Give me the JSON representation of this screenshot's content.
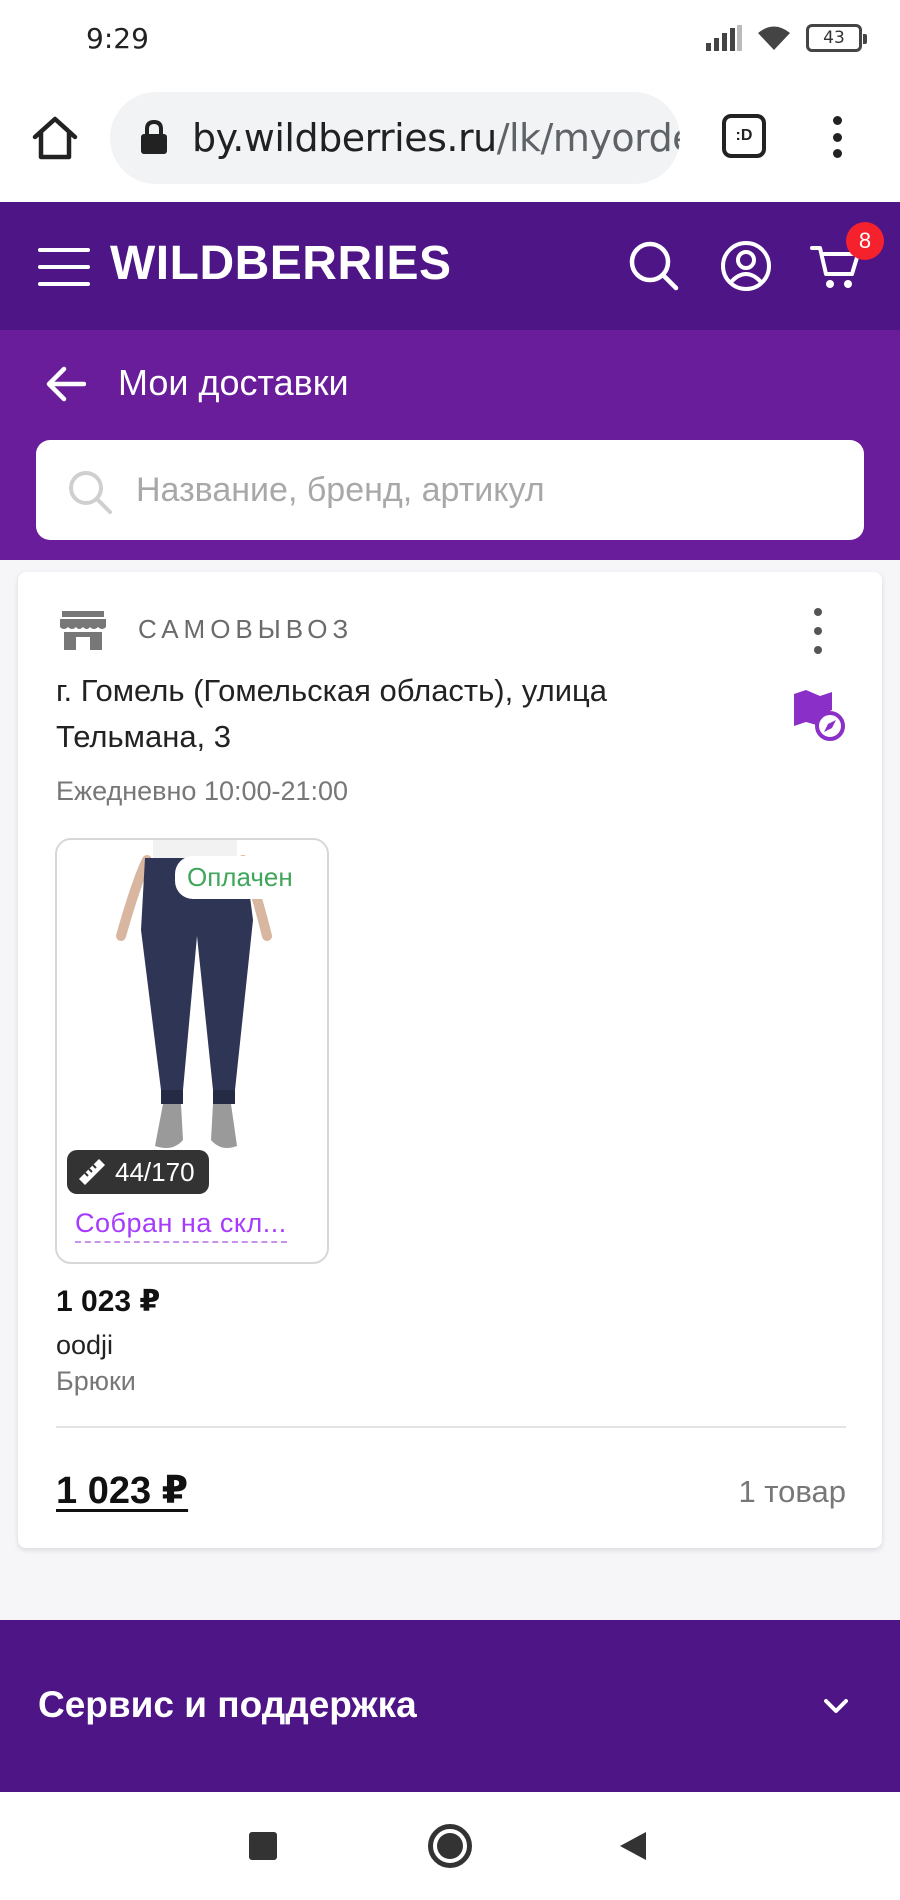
{
  "status_bar": {
    "time": "9:29",
    "battery": "43",
    "icons": [
      "signal-icon",
      "wifi-icon",
      "battery-icon"
    ]
  },
  "browser": {
    "url_host": "by.wildberries.ru",
    "url_path": "/lk/myorders",
    "tabs_label": ":D",
    "icons": [
      "home-icon",
      "lock-icon",
      "tabs-icon",
      "kebab-menu-icon"
    ]
  },
  "header": {
    "logo": "WILDBERRIES",
    "cart_count": "8",
    "accent_color": "#4d1585",
    "icons": [
      "hamburger-icon",
      "search-icon",
      "user-icon",
      "cart-icon"
    ]
  },
  "subheader": {
    "title": "Мои доставки",
    "accent_color": "#6a1d9a"
  },
  "search": {
    "placeholder": "Название, бренд, артикул",
    "value": ""
  },
  "delivery": {
    "type_label": "САМОВЫВОЗ",
    "address": "г. Гомель (Гомельская область), улица Тельмана, 3",
    "hours": "Ежедневно 10:00-21:00",
    "item": {
      "payment_status": "Оплачен",
      "size": "44/170",
      "status": "Собран на скл...",
      "price": "1 023 ₽",
      "brand": "oodji",
      "type": "Брюки"
    },
    "total": "1 023 ₽",
    "count": "1 товар",
    "icons": [
      "store-icon",
      "map-pin-icon",
      "ruler-icon",
      "kebab-menu-icon"
    ]
  },
  "footer": {
    "title": "Сервис и поддержка"
  }
}
